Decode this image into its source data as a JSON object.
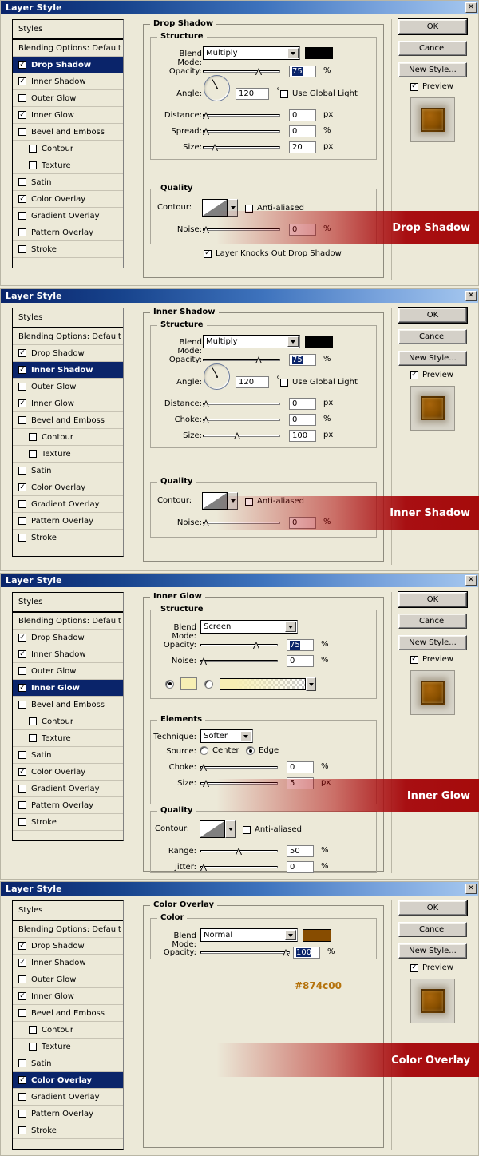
{
  "window": {
    "title": "Layer Style",
    "close_icon": "close-icon",
    "close_glyph": "✕"
  },
  "buttons": {
    "ok": "OK",
    "cancel": "Cancel",
    "new_style": "New Style...",
    "preview": "Preview"
  },
  "styles_list": {
    "header": "Styles",
    "blending_options": "Blending Options: Default",
    "items": [
      {
        "label": "Drop Shadow",
        "indent": false
      },
      {
        "label": "Inner Shadow",
        "indent": false
      },
      {
        "label": "Outer Glow",
        "indent": false
      },
      {
        "label": "Inner Glow",
        "indent": false
      },
      {
        "label": "Bevel and Emboss",
        "indent": false
      },
      {
        "label": "Contour",
        "indent": true
      },
      {
        "label": "Texture",
        "indent": true
      },
      {
        "label": "Satin",
        "indent": false
      },
      {
        "label": "Color Overlay",
        "indent": false
      },
      {
        "label": "Gradient Overlay",
        "indent": false
      },
      {
        "label": "Pattern Overlay",
        "indent": false
      },
      {
        "label": "Stroke",
        "indent": false
      }
    ]
  },
  "labels": {
    "structure": "Structure",
    "quality": "Quality",
    "elements": "Elements",
    "color": "Color",
    "blend_mode": "Blend Mode:",
    "opacity": "Opacity:",
    "angle": "Angle:",
    "use_global_light": "Use Global Light",
    "distance": "Distance:",
    "spread": "Spread:",
    "choke": "Choke:",
    "size": "Size:",
    "contour": "Contour:",
    "anti_aliased": "Anti-aliased",
    "noise": "Noise:",
    "layer_knocks_out": "Layer Knocks Out Drop Shadow",
    "technique": "Technique:",
    "source": "Source:",
    "center": "Center",
    "edge": "Edge",
    "range": "Range:",
    "jitter": "Jitter:",
    "degree": "°",
    "pct": "%",
    "px": "px"
  },
  "panels": [
    {
      "id": "drop-shadow",
      "group_title": "Drop Shadow",
      "banner_text": "Drop Shadow",
      "selected_style": "Drop Shadow",
      "checked_styles": [
        "Drop Shadow",
        "Inner Shadow",
        "Inner Glow",
        "Color Overlay"
      ],
      "blend_mode": "Multiply",
      "blend_color": "#000000",
      "opacity": "75",
      "angle": "120",
      "use_global_light_checked": false,
      "distance": "0",
      "spread": "0",
      "size": "20",
      "noise": "0",
      "anti_aliased_checked": false,
      "layer_knocks_out_checked": true
    },
    {
      "id": "inner-shadow",
      "group_title": "Inner Shadow",
      "banner_text": "Inner Shadow",
      "selected_style": "Inner Shadow",
      "checked_styles": [
        "Drop Shadow",
        "Inner Shadow",
        "Inner Glow",
        "Color Overlay"
      ],
      "blend_mode": "Multiply",
      "blend_color": "#000000",
      "opacity": "75",
      "angle": "120",
      "use_global_light_checked": false,
      "distance": "0",
      "choke": "0",
      "size": "100",
      "noise": "0",
      "anti_aliased_checked": false
    },
    {
      "id": "inner-glow",
      "group_title": "Inner Glow",
      "banner_text": "Inner Glow",
      "selected_style": "Inner Glow",
      "checked_styles": [
        "Drop Shadow",
        "Inner Shadow",
        "Inner Glow",
        "Color Overlay"
      ],
      "blend_mode": "Screen",
      "opacity": "75",
      "noise": "0",
      "glow_color": "#f7efb4",
      "fill_type": "color",
      "technique": "Softer",
      "source": "Edge",
      "choke": "0",
      "size": "5",
      "anti_aliased_checked": false,
      "range": "50",
      "jitter": "0"
    },
    {
      "id": "color-overlay",
      "group_title": "Color Overlay",
      "banner_text": "Color Overlay",
      "selected_style": "Color Overlay",
      "checked_styles": [
        "Drop Shadow",
        "Inner Shadow",
        "Inner Glow",
        "Color Overlay"
      ],
      "blend_mode": "Normal",
      "blend_color": "#874c00",
      "opacity": "100",
      "hex_label": "#874c00"
    }
  ]
}
